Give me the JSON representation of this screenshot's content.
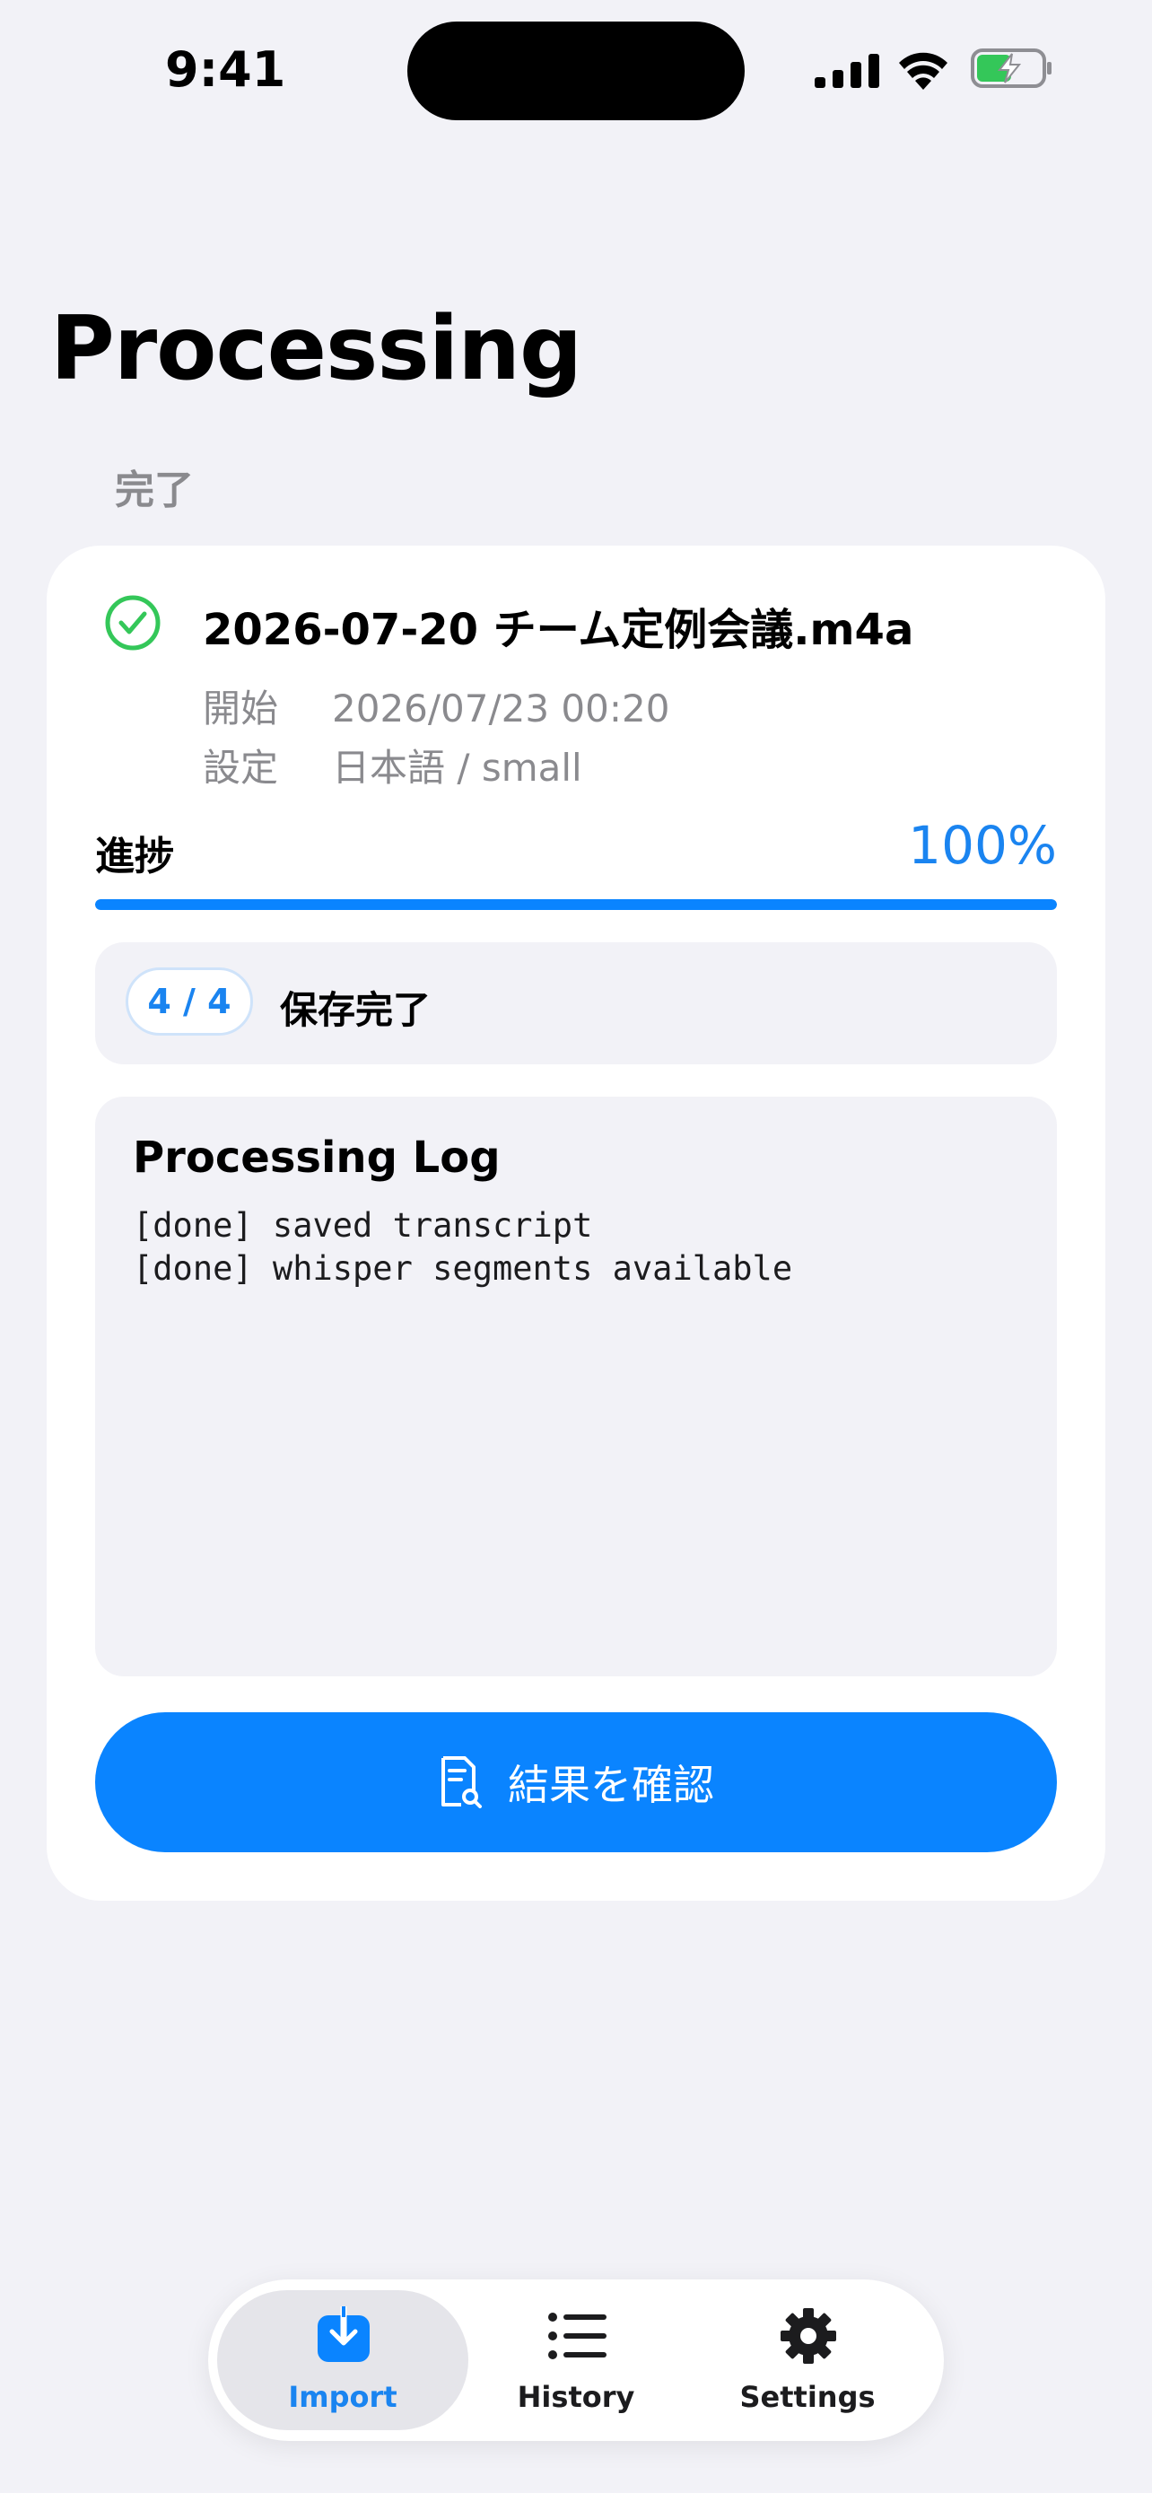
{
  "status_bar": {
    "time": "9:41"
  },
  "header": {
    "title": "Processing"
  },
  "section": {
    "label": "完了"
  },
  "job": {
    "file_name": "2026-07-20 チーム定例会議.m4a",
    "start_key": "開始",
    "start_value": "2026/07/23 00:20",
    "settings_key": "設定",
    "settings_value": "日本語 / small",
    "progress_label": "進捗",
    "progress_percent_text": "100%",
    "progress_fraction": 1.0,
    "step_badge": "4 / 4",
    "step_text": "保存完了"
  },
  "log": {
    "title": "Processing Log",
    "lines": [
      "[done] saved transcript",
      "[done] whisper segments available"
    ]
  },
  "actions": {
    "view_result_label": "結果を確認",
    "view_result_icon": "document-search-icon"
  },
  "tab_bar": {
    "tabs": [
      {
        "label": "Import",
        "icon": "import-icon",
        "selected": true
      },
      {
        "label": "History",
        "icon": "list-icon",
        "selected": false
      },
      {
        "label": "Settings",
        "icon": "gear-icon",
        "selected": false
      }
    ]
  },
  "colors": {
    "accent": "#0a84ff",
    "success": "#34c759",
    "background": "#f2f2f7"
  }
}
